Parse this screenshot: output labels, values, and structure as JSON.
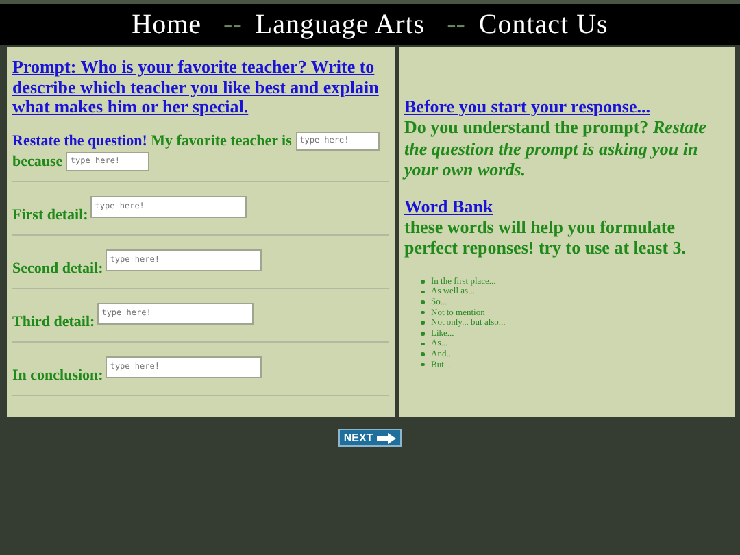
{
  "nav": [
    {
      "label": "Home"
    },
    {
      "label": "Language Arts",
      "separator": "--"
    },
    {
      "label": "Contact Us",
      "separator": "--"
    }
  ],
  "prompt": {
    "title": "Prompt: Who is your favorite teacher? Write to describe which teacher you like best and explain what makes him or her special."
  },
  "restate": {
    "lead": "Restate the question!",
    "label": "My favorite teacher is",
    "placeholder": "type here!",
    "because_label": "because",
    "because_placeholder": "type here!"
  },
  "details": [
    {
      "label": "First detail:",
      "placeholder": "type here!"
    },
    {
      "label": "Second detail:",
      "placeholder": "type here!"
    },
    {
      "label": "Third detail:",
      "placeholder": "type here!"
    },
    {
      "label": "In conclusion:",
      "placeholder": "type here!"
    }
  ],
  "tips": {
    "heading": "Before you start your response...",
    "question": "Do you understand the prompt?",
    "hint": "Restate the question the prompt is asking you in your own words."
  },
  "word_bank": {
    "heading": "Word Bank",
    "intro": "these words will help you formulate perfect reponses! try to use at least 3.",
    "words": [
      "In the first place...",
      "As well as...",
      "So...",
      "Not to mention",
      "Not only... but also...",
      "Like...",
      "As...",
      "And...",
      "But..."
    ]
  },
  "next_button": {
    "label": "NEXT"
  }
}
